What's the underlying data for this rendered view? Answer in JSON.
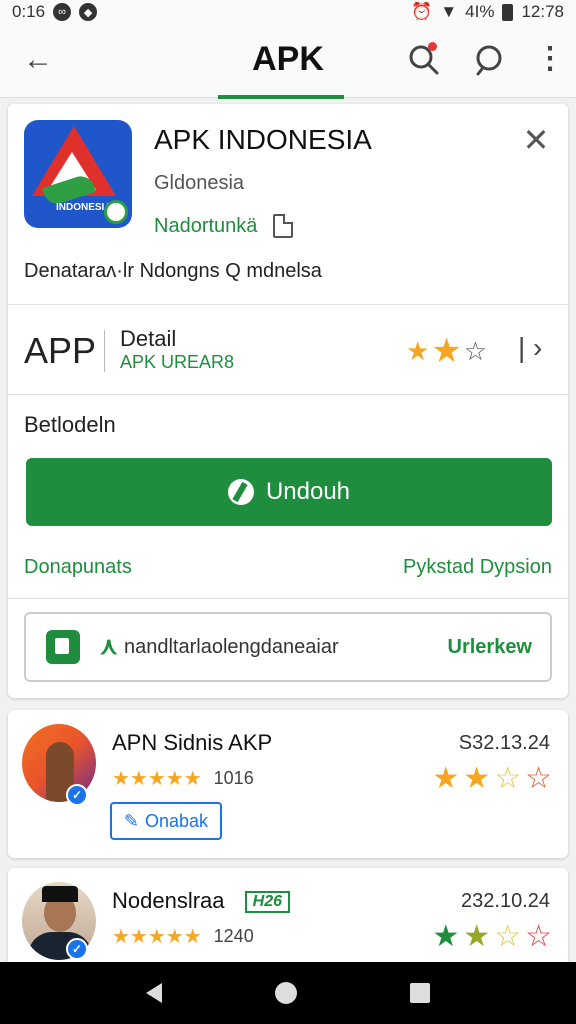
{
  "status": {
    "time_left": "0:16",
    "battery": "4I%",
    "time_right": "12:78"
  },
  "appbar": {
    "title": "APK",
    "back_icon": "arrow-left-icon",
    "search_icon": "search-icon",
    "more_icon": "more-vert-icon"
  },
  "app": {
    "name": "APK INDONESIA",
    "developer": "Gldonesia",
    "icon_text": "INDONESIA",
    "tag": "Nadortunkä",
    "description": "Denataraʌ·lr  Ndongns  Q mdnelsa"
  },
  "detail": {
    "label": "APP",
    "title": "Detail",
    "subtitle": "APK UREAR8",
    "rating": 2.5
  },
  "download": {
    "section_label": "Betlodeln",
    "button_label": "Undouh",
    "link_left": "Donapunats",
    "link_right": "Pykstad Dypsion"
  },
  "inner": {
    "text": "nandltarlaolengdaneaiar",
    "action": "Urlerkew"
  },
  "list": [
    {
      "title": "APN Sidnis AKP",
      "date": "S32.13.24",
      "stars": "★★★★★",
      "count": "1016",
      "chip": "Onabak",
      "chip_icon": "pencil-icon"
    },
    {
      "title": "Nodenslraa",
      "badge": "H26",
      "date": "232.10.24",
      "stars": "★★★★★",
      "count": "1240"
    }
  ],
  "colors": {
    "accent": "#1e8e3e",
    "link_blue": "#1a73e8",
    "star": "#f5a623"
  }
}
